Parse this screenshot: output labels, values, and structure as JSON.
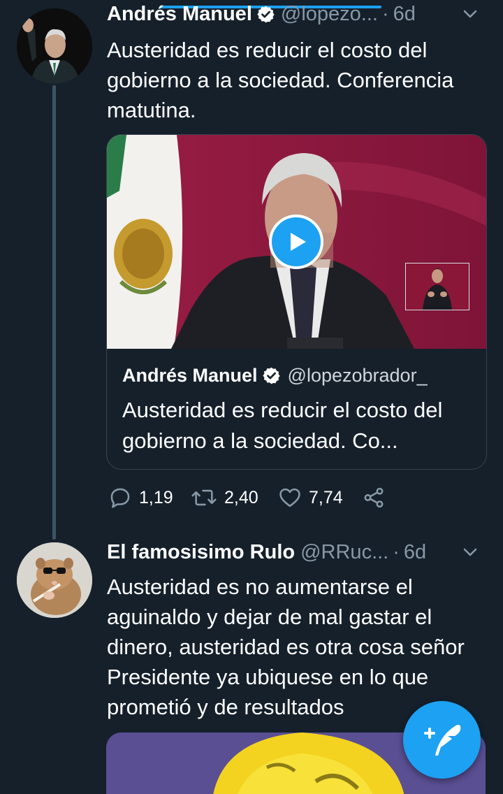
{
  "colors": {
    "background": "#15202b",
    "accent": "#1da1f2",
    "secondary_text": "#8899a6",
    "border": "#38444d"
  },
  "tweet1": {
    "display_name": "Andrés Manuel",
    "handle": "@lopezo...",
    "separator": "·",
    "time": "6d",
    "text": "Austeridad es reducir el costo del gobierno a la sociedad. Conferencia matutina.",
    "card": {
      "quoted_name": "Andrés Manuel",
      "quoted_handle": "@lopezobrador_",
      "quoted_text": "Austeridad es reducir el costo del gobierno a la sociedad. Co..."
    },
    "actions": {
      "replies": "1,19",
      "retweets": "2,40",
      "likes": "7,74"
    }
  },
  "tweet2": {
    "display_name": "El famosisimo Rulo",
    "handle": "@RRuc...",
    "separator": "·",
    "time": "6d",
    "text": "Austeridad es no aumentarse el aguinaldo y dejar de mal gastar el dinero, austeridad es otra cosa señor Presidente ya ubiquese en lo que prometió y de resultados"
  },
  "icons": {
    "verified": "verified-badge-icon",
    "chevron": "chevron-down-icon",
    "reply": "reply-bubble-icon",
    "retweet": "retweet-icon",
    "like": "heart-icon",
    "share": "share-icon",
    "play": "play-icon",
    "compose": "compose-tweet-icon"
  }
}
